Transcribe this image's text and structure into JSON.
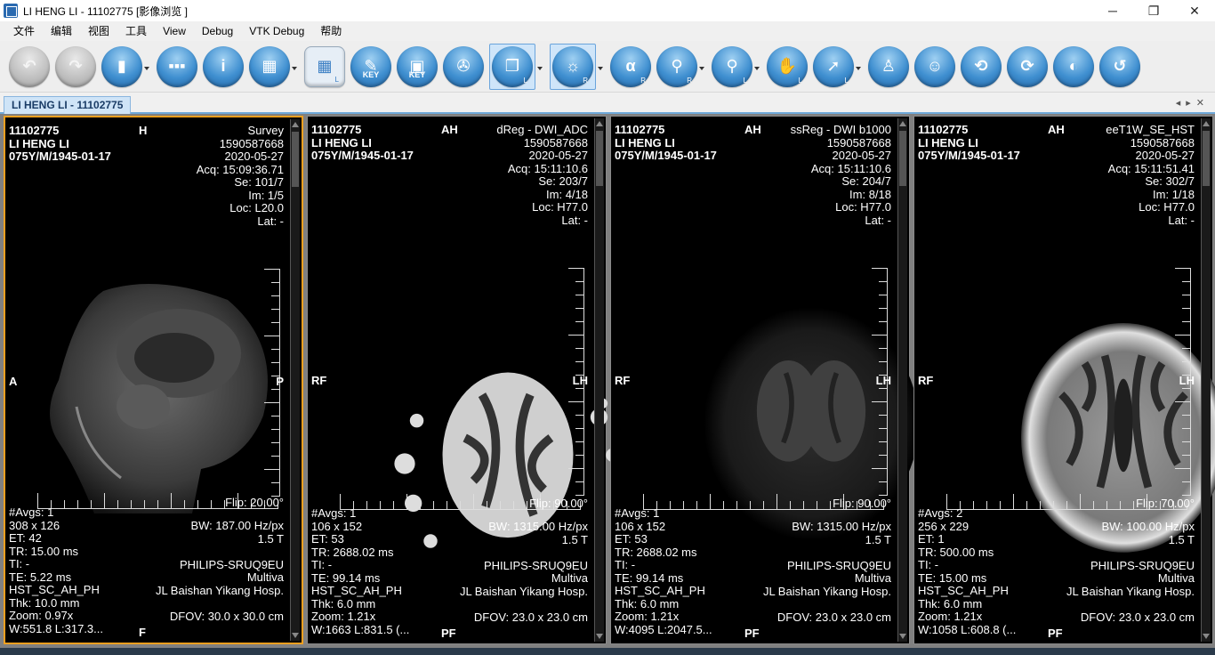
{
  "window": {
    "title": "LI HENG LI - 11102775 [影像浏览 ]",
    "minimize": "─",
    "maximize": "❐",
    "close": "✕"
  },
  "menu": [
    "文件",
    "编辑",
    "视图",
    "工具",
    "View",
    "Debug",
    "VTK Debug",
    "帮助"
  ],
  "toolbar": {
    "key1": "KEY",
    "key2": "KEY",
    "alpha": "α",
    "sub_l": "L",
    "sub_r": "R"
  },
  "tab": {
    "label": "LI HENG LI - 11102775"
  },
  "viewports": [
    {
      "id": "11102775",
      "name": "LI HENG LI",
      "age": "075Y/M/1945-01-17",
      "orient_top": "H",
      "series": "Survey",
      "acc": "1590587668",
      "date": "2020-05-27",
      "acq": "Acq: 15:09:36.71",
      "se": "Se: 101/7",
      "im": "Im: 1/5",
      "loc": "Loc: L20.0",
      "lat": "Lat: -",
      "left": "A",
      "right": "P",
      "flip": "Flip: 20.00°",
      "avgs": "#Avgs: 1",
      "matrix": "308 x 126",
      "et": "ET: 42",
      "tr": "TR: 15.00 ms",
      "ti": "TI: -",
      "te": "TE: 5.22 ms",
      "protocol": "HST_SC_AH_PH",
      "thk": "Thk: 10.0 mm",
      "zoom": "Zoom: 0.97x",
      "wl": "W:551.8 L:317.3...",
      "bottom": "F",
      "bw": "BW: 187.00 Hz/px",
      "field": "1.5 T",
      "maker": "PHILIPS-SRUQ9EU",
      "model": "Multiva",
      "hosp": "JL Baishan Yikang Hosp.",
      "dfov": "DFOV: 30.0 x 30.0 cm"
    },
    {
      "id": "11102775",
      "name": "LI HENG LI",
      "age": "075Y/M/1945-01-17",
      "orient_top": "AH",
      "series": "dReg - DWI_ADC",
      "acc": "1590587668",
      "date": "2020-05-27",
      "acq": "Acq: 15:11:10.6",
      "se": "Se: 203/7",
      "im": "Im: 4/18",
      "loc": "Loc: H77.0",
      "lat": "Lat: -",
      "left": "RF",
      "right": "LH",
      "flip": "Flip: 90.00°",
      "avgs": "#Avgs: 1",
      "matrix": "106 x 152",
      "et": "ET: 53",
      "tr": "TR: 2688.02 ms",
      "ti": "TI: -",
      "te": "TE: 99.14 ms",
      "protocol": "HST_SC_AH_PH",
      "thk": "Thk: 6.0 mm",
      "zoom": "Zoom: 1.21x",
      "wl": "W:1663 L:831.5 (...",
      "bottom": "PF",
      "bw": "BW: 1315.00 Hz/px",
      "field": "1.5 T",
      "maker": "PHILIPS-SRUQ9EU",
      "model": "Multiva",
      "hosp": "JL Baishan Yikang Hosp.",
      "dfov": "DFOV: 23.0 x 23.0 cm"
    },
    {
      "id": "11102775",
      "name": "LI HENG LI",
      "age": "075Y/M/1945-01-17",
      "orient_top": "AH",
      "series": "ssReg - DWI b1000",
      "acc": "1590587668",
      "date": "2020-05-27",
      "acq": "Acq: 15:11:10.6",
      "se": "Se: 204/7",
      "im": "Im: 8/18",
      "loc": "Loc: H77.0",
      "lat": "Lat: -",
      "left": "RF",
      "right": "LH",
      "flip": "Flip: 90.00°",
      "avgs": "#Avgs: 1",
      "matrix": "106 x 152",
      "et": "ET: 53",
      "tr": "TR: 2688.02 ms",
      "ti": "TI: -",
      "te": "TE: 99.14 ms",
      "protocol": "HST_SC_AH_PH",
      "thk": "Thk: 6.0 mm",
      "zoom": "Zoom: 1.21x",
      "wl": "W:4095 L:2047.5...",
      "bottom": "PF",
      "bw": "BW: 1315.00 Hz/px",
      "field": "1.5 T",
      "maker": "PHILIPS-SRUQ9EU",
      "model": "Multiva",
      "hosp": "JL Baishan Yikang Hosp.",
      "dfov": "DFOV: 23.0 x 23.0 cm"
    },
    {
      "id": "11102775",
      "name": "LI HENG LI",
      "age": "075Y/M/1945-01-17",
      "orient_top": "AH",
      "series": "eeT1W_SE_HST",
      "acc": "1590587668",
      "date": "2020-05-27",
      "acq": "Acq: 15:11:51.41",
      "se": "Se: 302/7",
      "im": "Im: 1/18",
      "loc": "Loc: H77.0",
      "lat": "Lat: -",
      "left": "RF",
      "right": "LH",
      "flip": "Flip: 70.00°",
      "avgs": "#Avgs: 2",
      "matrix": "256 x 229",
      "et": "ET: 1",
      "tr": "TR: 500.00 ms",
      "ti": "TI: -",
      "te": "TE: 15.00 ms",
      "protocol": "HST_SC_AH_PH",
      "thk": "Thk: 6.0 mm",
      "zoom": "Zoom: 1.21x",
      "wl": "W:1058 L:608.8 (...",
      "bottom": "PF",
      "bw": "BW: 100.00 Hz/px",
      "field": "1.5 T",
      "maker": "PHILIPS-SRUQ9EU",
      "model": "Multiva",
      "hosp": "JL Baishan Yikang Hosp.",
      "dfov": "DFOV: 23.0 x 23.0 cm"
    }
  ]
}
